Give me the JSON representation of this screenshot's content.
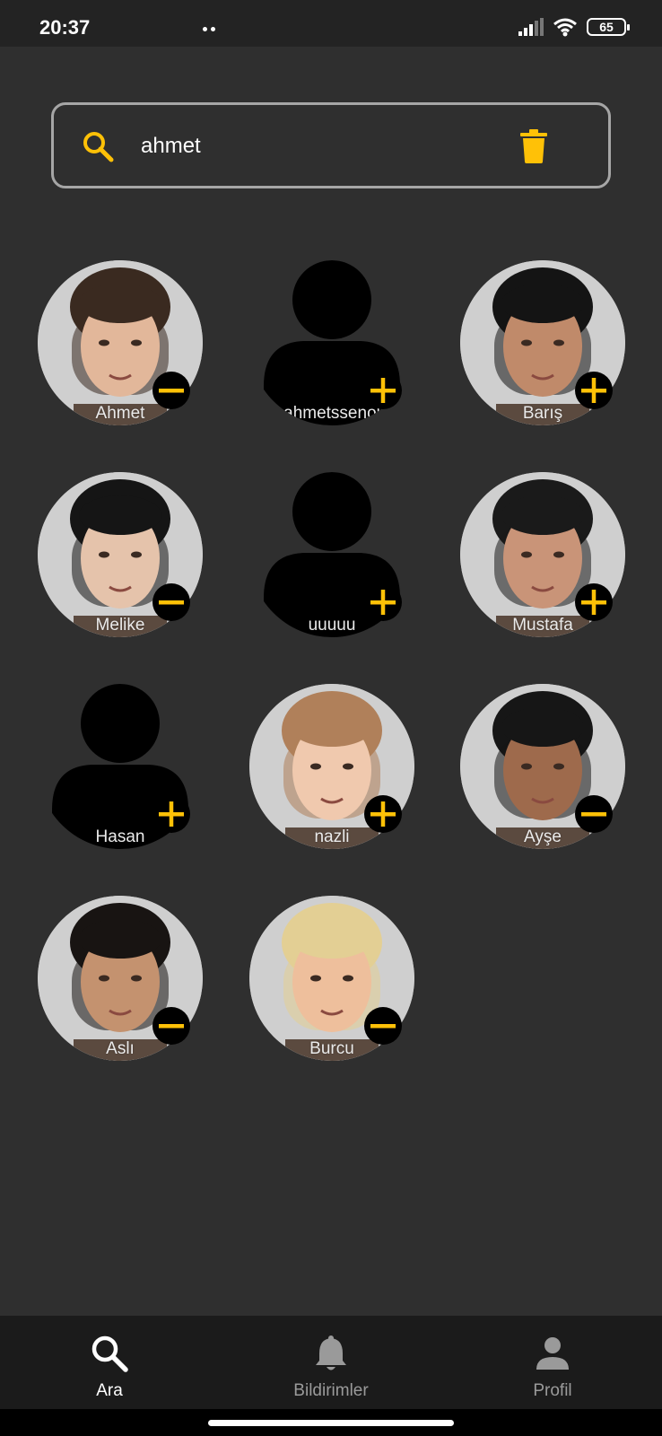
{
  "status": {
    "time": "20:37",
    "battery": "65"
  },
  "search": {
    "value": "ahmet"
  },
  "users": [
    {
      "name": "Ahmet",
      "action": "remove",
      "photo": true,
      "hair": "#3a2a20",
      "skin": "#e2b79a"
    },
    {
      "name": "ahmetssenol",
      "action": "add",
      "photo": false
    },
    {
      "name": "Barış",
      "action": "add",
      "photo": true,
      "hair": "#141414",
      "skin": "#c08a6a"
    },
    {
      "name": "Melike",
      "action": "remove",
      "photo": true,
      "hair": "#151515",
      "skin": "#e5c3ab"
    },
    {
      "name": "uuuuu",
      "action": "add",
      "photo": false
    },
    {
      "name": "Mustafa",
      "action": "add",
      "photo": true,
      "hair": "#1a1a1a",
      "skin": "#c99478"
    },
    {
      "name": "Hasan",
      "action": "add",
      "photo": false
    },
    {
      "name": "nazli",
      "action": "add",
      "photo": true,
      "hair": "#b0805a",
      "skin": "#f0c9ae"
    },
    {
      "name": "Ayşe",
      "action": "remove",
      "photo": true,
      "hair": "#161616",
      "skin": "#9e6a4c"
    },
    {
      "name": "Aslı",
      "action": "remove",
      "photo": true,
      "hair": "#181412",
      "skin": "#c4926f"
    },
    {
      "name": "Burcu",
      "action": "remove",
      "photo": true,
      "hair": "#e3cf94",
      "skin": "#eebf9c"
    }
  ],
  "nav": {
    "items": [
      {
        "label": "Ara",
        "active": true
      },
      {
        "label": "Bildirimler",
        "active": false
      },
      {
        "label": "Profil",
        "active": false
      }
    ]
  },
  "colors": {
    "accent": "#ffc107",
    "background": "#2f2f2f",
    "nav_inactive": "#9a9a9a"
  }
}
